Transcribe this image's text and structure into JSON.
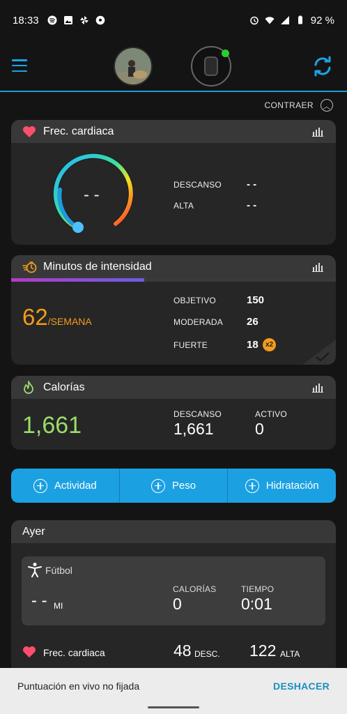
{
  "status_bar": {
    "time": "18:33",
    "battery": "92 %"
  },
  "header": {
    "collapse_label": "CONTRAER"
  },
  "heart_rate": {
    "title": "Frec. cardiaca",
    "current": "- -",
    "rest_label": "DESCANSO",
    "rest_value": "- -",
    "high_label": "ALTA",
    "high_value": "- -"
  },
  "intensity": {
    "title": "Minutos de intensidad",
    "progress": 0.41,
    "value": "62",
    "unit": "/SEMANA",
    "goal_label": "OBJETIVO",
    "goal_value": "150",
    "moderate_label": "MODERADA",
    "moderate_value": "26",
    "vigorous_label": "FUERTE",
    "vigorous_value": "18",
    "multiplier": "x2"
  },
  "calories": {
    "title": "Calorías",
    "total": "1,661",
    "rest_label": "DESCANSO",
    "rest_value": "1,661",
    "active_label": "ACTIVO",
    "active_value": "0"
  },
  "actions": [
    {
      "label": "Actividad"
    },
    {
      "label": "Peso"
    },
    {
      "label": "Hidratación"
    }
  ],
  "yesterday": {
    "title": "Ayer",
    "activity": {
      "name": "Fútbol",
      "distance": "- -",
      "distance_unit": "MI",
      "cal_label": "CALORÍAS",
      "cal_value": "0",
      "time_label": "TIEMPO",
      "time_value": "0:01"
    },
    "hr_label": "Frec. cardiaca",
    "hr_rest": "48",
    "hr_rest_unit": "DESC.",
    "hr_high": "122",
    "hr_high_unit": "ALTA"
  },
  "snackbar": {
    "message": "Puntuación en vivo no fijada",
    "action": "DESHACER"
  },
  "colors": {
    "accent": "#1ba1e2",
    "intensity": "#f39c1b",
    "calories": "#9bdc6a",
    "heart": "#ff4d6d"
  }
}
